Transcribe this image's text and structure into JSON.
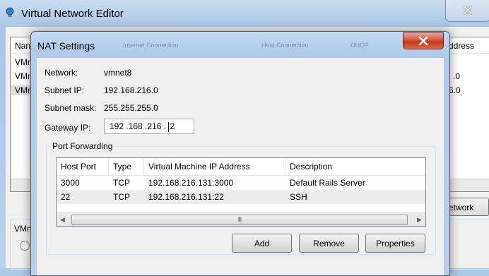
{
  "background_window": {
    "title": "Virtual Network Editor",
    "list_header": [
      "Nan",
      "ddress"
    ],
    "rows": [
      {
        "name": "VMn",
        "tail": ""
      },
      {
        "name": "VMn",
        "tail": ".0"
      },
      {
        "name": "VMn",
        "tail": "6.0"
      }
    ],
    "right_button_label": "etwork",
    "group_label": "VMn"
  },
  "dialog": {
    "title": "NAT Settings",
    "ghost_headers": [
      "Internet Connection",
      "Host Connection",
      "DHCP"
    ],
    "network_label": "Network:",
    "network_value": "vmnet8",
    "subnet_ip_label": "Subnet IP:",
    "subnet_ip_value": "192.168.216.0",
    "subnet_mask_label": "Subnet mask:",
    "subnet_mask_value": "255.255.255.0",
    "gateway_label": "Gateway IP:",
    "gateway_value_prefix": "192 .168 .216 . ",
    "gateway_value_last": "2",
    "port_forwarding": {
      "legend": "Port Forwarding",
      "columns": [
        "Host Port",
        "Type",
        "Virtual Machine IP Address",
        "Description"
      ],
      "rows": [
        {
          "host_port": "3000",
          "type": "TCP",
          "vm_ip": "192.168.216.131:3000",
          "description": "Default Rails Server"
        },
        {
          "host_port": "22",
          "type": "TCP",
          "vm_ip": "192.168.216.131:22",
          "description": "SSH"
        }
      ],
      "scroll_grip": "III"
    },
    "buttons": {
      "add": "Add",
      "remove": "Remove",
      "properties": "Properties"
    }
  },
  "colors": {
    "title_close_red": "#c0391f",
    "selection": "#dcdcdc"
  }
}
